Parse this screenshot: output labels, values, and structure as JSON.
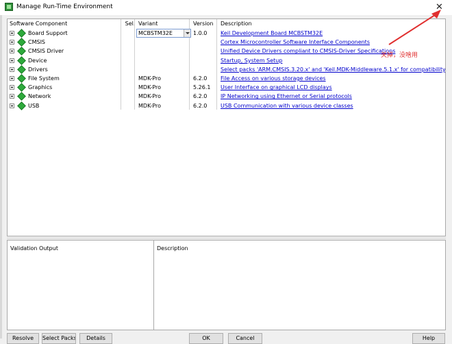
{
  "window": {
    "title": "Manage Run-Time Environment",
    "icon": "rte-app-icon",
    "close_glyph": "✕"
  },
  "grid": {
    "headers": {
      "component": "Software Component",
      "sel": "Sel.",
      "variant": "Variant",
      "version": "Version",
      "description": "Description"
    },
    "rows": [
      {
        "name": "Board Support",
        "sel": "",
        "variant": "MCBSTM32E",
        "variant_is_dropdown": true,
        "version": "1.0.0",
        "description": "Keil Development Board MCBSTM32E"
      },
      {
        "name": "CMSIS",
        "sel": "",
        "variant": "",
        "version": "",
        "description": "Cortex Microcontroller Software Interface Components"
      },
      {
        "name": "CMSIS Driver",
        "sel": "",
        "variant": "",
        "version": "",
        "description": "Unified Device Drivers compliant to CMSIS-Driver Specifications"
      },
      {
        "name": "Device",
        "sel": "",
        "variant": "",
        "version": "",
        "description": "Startup, System Setup"
      },
      {
        "name": "Drivers",
        "sel": "",
        "variant": "",
        "version": "",
        "description": "Select packs 'ARM.CMSIS.3.20.x' and 'Keil.MDK-Middleware.5.1.x' for compatibility"
      },
      {
        "name": "File System",
        "sel": "",
        "variant": "MDK-Pro",
        "version": "6.2.0",
        "description": "File Access on various storage devices"
      },
      {
        "name": "Graphics",
        "sel": "",
        "variant": "MDK-Pro",
        "version": "5.26.1",
        "description": "User Interface on graphical LCD displays"
      },
      {
        "name": "Network",
        "sel": "",
        "variant": "MDK-Pro",
        "version": "6.2.0",
        "description": "IP Networking using Ethernet or Serial protocols"
      },
      {
        "name": "USB",
        "sel": "",
        "variant": "MDK-Pro",
        "version": "6.2.0",
        "description": "USB Communication with various device classes"
      }
    ]
  },
  "annotation": {
    "text": "关掉，没啥用",
    "color": "#e03030"
  },
  "bottom": {
    "validation_label": "Validation Output",
    "description_label": "Description"
  },
  "buttons": {
    "resolve": "Resolve",
    "select_packs": "Select Packs",
    "details": "Details",
    "ok": "OK",
    "cancel": "Cancel",
    "help": "Help"
  },
  "colors": {
    "link": "#0000cc",
    "component_icon": "#2eaa3c"
  }
}
